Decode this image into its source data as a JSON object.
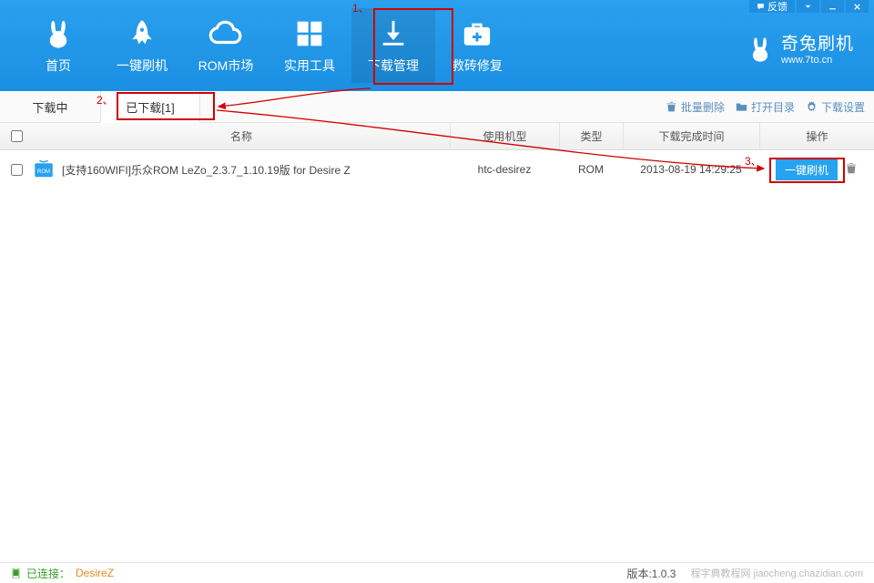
{
  "titlebar": {
    "feedback": "反馈"
  },
  "nav": {
    "items": [
      {
        "label": "首页"
      },
      {
        "label": "一键刷机"
      },
      {
        "label": "ROM市场"
      },
      {
        "label": "实用工具"
      },
      {
        "label": "下载管理"
      },
      {
        "label": "救砖修复"
      }
    ]
  },
  "brand": {
    "name": "奇兔刷机",
    "url": "www.7to.cn"
  },
  "tabs": {
    "downloading": "下载中",
    "downloaded": "已下载[1]"
  },
  "tabbar_actions": {
    "batch_delete": "批量删除",
    "open_dir": "打开目录",
    "settings": "下载设置"
  },
  "columns": {
    "name": "名称",
    "device": "使用机型",
    "type": "类型",
    "time": "下载完成时间",
    "op": "操作"
  },
  "rows": [
    {
      "name": "[支持160WIFI]乐众ROM LeZo_2.3.7_1.10.19版 for Desire Z",
      "device": "htc-desirez",
      "type": "ROM",
      "time": "2013-08-19 14:29:25",
      "flash_label": "一键刷机"
    }
  ],
  "status": {
    "connected_label": "已连接：",
    "connected_device": "DesireZ",
    "version_label": "版本:1.0.3",
    "watermark": "程字典教程网 jiaocheng.chazidian.com"
  },
  "annotations": {
    "a1": "1、",
    "a2": "2、",
    "a3": "3、"
  }
}
